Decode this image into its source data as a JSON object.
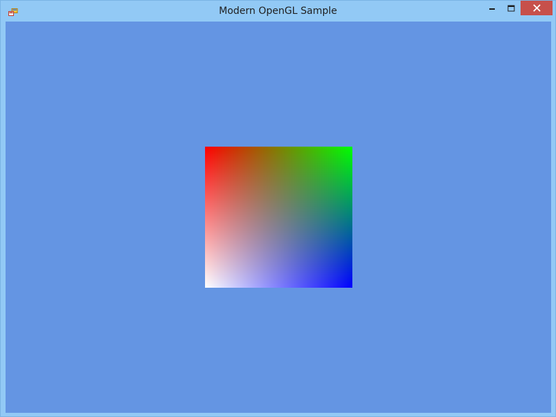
{
  "window": {
    "title": "Modern OpenGL Sample",
    "app_icon": "app-icon",
    "controls": {
      "minimize_icon": "minimize-icon",
      "maximize_icon": "maximize-icon",
      "close_icon": "close-icon"
    },
    "colors": {
      "titlebar": "#92c9f5",
      "close_button": "#c7504b",
      "viewport_background": "#6495e3"
    }
  },
  "viewport": {
    "quad_vertex_colors": {
      "top_left": "#ff0000",
      "top_right": "#00ff00",
      "bottom_left": "#ffffff",
      "bottom_right": "#0000ff"
    }
  }
}
